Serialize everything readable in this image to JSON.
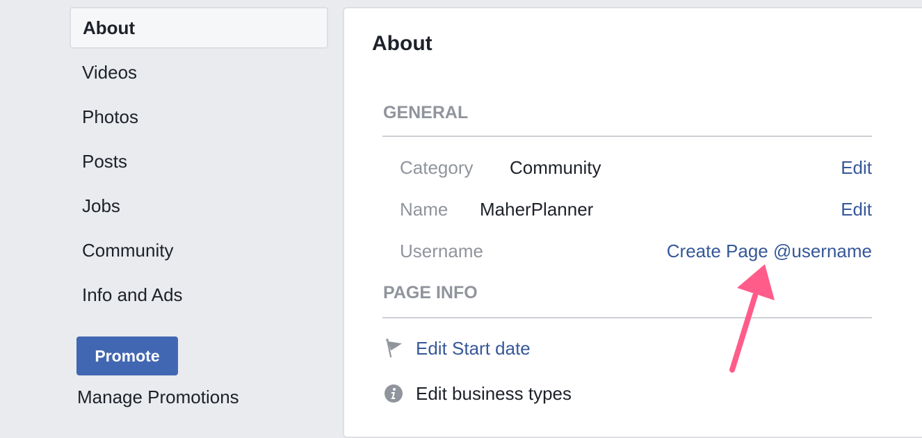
{
  "sidebar": {
    "items": [
      {
        "label": "About",
        "active": true
      },
      {
        "label": "Videos"
      },
      {
        "label": "Photos"
      },
      {
        "label": "Posts"
      },
      {
        "label": "Jobs"
      },
      {
        "label": "Community"
      },
      {
        "label": "Info and Ads"
      }
    ],
    "promote_label": "Promote",
    "manage_promotions_label": "Manage Promotions"
  },
  "main": {
    "title": "About",
    "general": {
      "header": "GENERAL",
      "rows": [
        {
          "label": "Category",
          "value": "Community",
          "action": "Edit"
        },
        {
          "label": "Name",
          "value": "MaherPlanner",
          "action": "Edit"
        },
        {
          "label": "Username",
          "action": "Create Page @username"
        }
      ]
    },
    "page_info": {
      "header": "PAGE INFO",
      "items": [
        {
          "icon": "flag-icon",
          "label": "Edit Start date"
        },
        {
          "icon": "info-icon",
          "label": "Edit business types"
        }
      ]
    }
  },
  "annotation": {
    "type": "arrow",
    "color": "#ff5c8a",
    "points_to": "Create Page @username"
  }
}
